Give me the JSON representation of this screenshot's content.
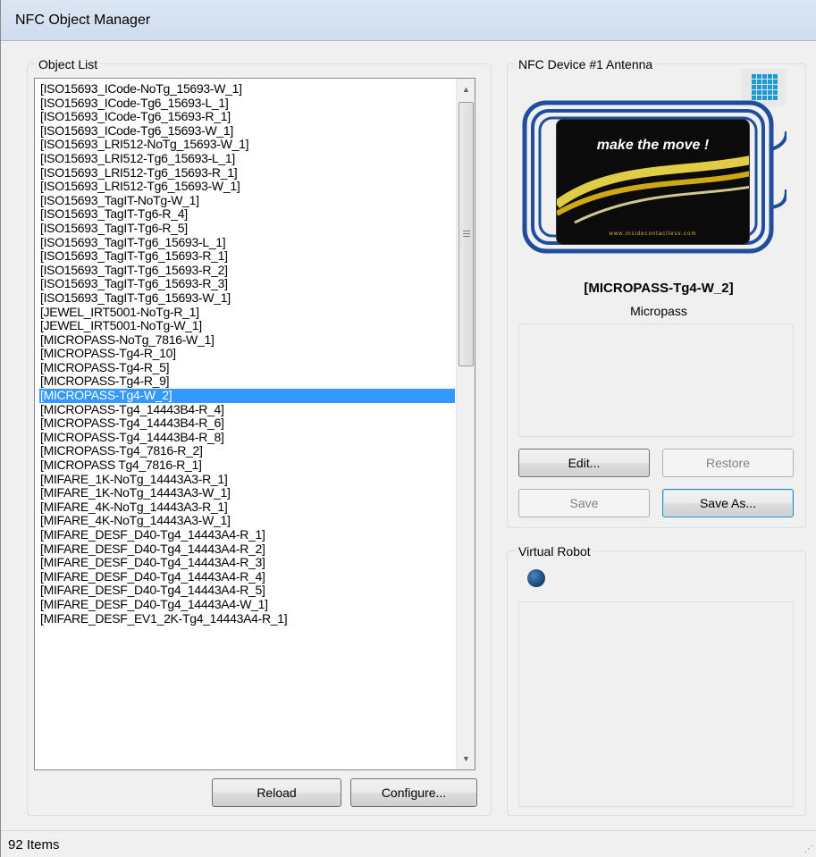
{
  "window": {
    "title": "NFC Object Manager"
  },
  "object_list": {
    "label": "Object List",
    "selected_index": 19,
    "items": [
      "[ISO15693_ICode-NoTg_15693-W_1]",
      "[ISO15693_ICode-Tg6_15693-L_1]",
      "[ISO15693_ICode-Tg6_15693-R_1]",
      "[ISO15693_ICode-Tg6_15693-W_1]",
      "[ISO15693_LRI512-NoTg_15693-W_1]",
      "[ISO15693_LRI512-Tg6_15693-L_1]",
      "[ISO15693_LRI512-Tg6_15693-R_1]",
      "[ISO15693_LRI512-Tg6_15693-W_1]",
      "[ISO15693_TagIT-NoTg-W_1]",
      "[ISO15693_TagIT-Tg6-R_4]",
      "[ISO15693_TagIT-Tg6-R_5]",
      "[ISO15693_TagIT-Tg6_15693-L_1]",
      "[ISO15693_TagIT-Tg6_15693-R_1]",
      "[ISO15693_TagIT-Tg6_15693-R_2]",
      "[ISO15693_TagIT-Tg6_15693-R_3]",
      "[ISO15693_TagIT-Tg6_15693-W_1]",
      "[JEWEL_IRT5001-NoTg-R_1]",
      "[JEWEL_IRT5001-NoTg-W_1]",
      "[MICROPASS-NoTg_7816-W_1]",
      "[MICROPASS-Tg4-R_10]",
      "[MICROPASS-Tg4-R_5]",
      "[MICROPASS-Tg4-R_9]",
      "[MICROPASS-Tg4-W_2]",
      "[MICROPASS-Tg4_14443B4-R_4]",
      "[MICROPASS-Tg4_14443B4-R_6]",
      "[MICROPASS-Tg4_14443B4-R_8]",
      "[MICROPASS-Tg4_7816-R_2]",
      "[MICROPASS Tg4_7816-R_1]",
      "[MIFARE_1K-NoTg_14443A3-R_1]",
      "[MIFARE_1K-NoTg_14443A3-W_1]",
      "[MIFARE_4K-NoTg_14443A3-R_1]",
      "[MIFARE_4K-NoTg_14443A3-W_1]",
      "[MIFARE_DESF_D40-Tg4_14443A4-R_1]",
      "[MIFARE_DESF_D40-Tg4_14443A4-R_2]",
      "[MIFARE_DESF_D40-Tg4_14443A4-R_3]",
      "[MIFARE_DESF_D40-Tg4_14443A4-R_4]",
      "[MIFARE_DESF_D40-Tg4_14443A4-R_5]",
      "[MIFARE_DESF_D40-Tg4_14443A4-W_1]",
      "[MIFARE_DESF_EV1_2K-Tg4_14443A4-R_1]"
    ],
    "reload_label": "Reload",
    "configure_label": "Configure..."
  },
  "antenna": {
    "label": "NFC Device #1 Antenna",
    "card_slogan": "make the move !",
    "card_url": "www.insidecontactless.com",
    "object_name": "[MICROPASS-Tg4-W_2]",
    "object_type": "Micropass",
    "edit_label": "Edit...",
    "restore_label": "Restore",
    "save_label": "Save",
    "save_as_label": "Save As..."
  },
  "virtual_robot": {
    "label": "Virtual Robot"
  },
  "status": {
    "text": "92 Items"
  },
  "colors": {
    "selection": "#3399ff",
    "antenna_blue": "#1f4f9c",
    "robot_dot": "#1c4a7a"
  }
}
